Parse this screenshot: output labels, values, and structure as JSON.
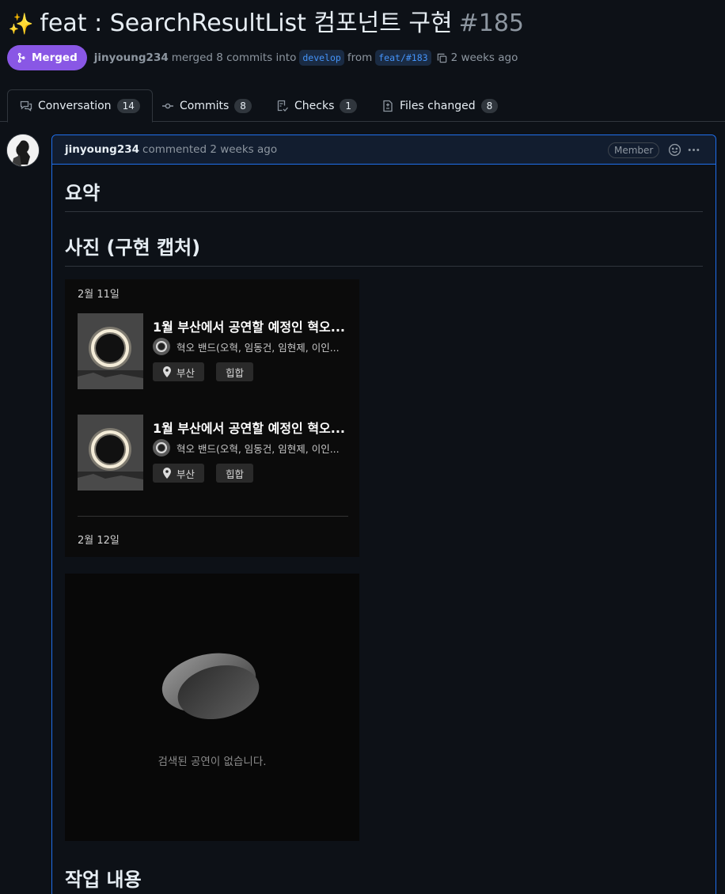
{
  "pr": {
    "title": "feat : SearchResultList 컴포넌트 구현",
    "number": "#185",
    "state": "Merged",
    "author": "jinyoung234",
    "merge_text": "merged 8 commits into",
    "base_branch": "develop",
    "from_text": "from",
    "head_branch": "feat/#183",
    "time": "2 weeks ago"
  },
  "tabs": [
    {
      "label": "Conversation",
      "count": "14",
      "icon": "comment-discussion-icon"
    },
    {
      "label": "Commits",
      "count": "8",
      "icon": "git-commit-icon"
    },
    {
      "label": "Checks",
      "count": "1",
      "icon": "checklist-icon"
    },
    {
      "label": "Files changed",
      "count": "8",
      "icon": "file-diff-icon"
    }
  ],
  "comment": {
    "author": "jinyoung234",
    "action": "commented 2 weeks ago",
    "badge": "Member"
  },
  "body": {
    "h_summary": "요약",
    "h_photos": "사진 (구현 캡처)",
    "h_work": "작업 내용"
  },
  "screenshot1": {
    "date1": "2월 11일",
    "date2": "2월 12일",
    "cards": [
      {
        "title": "1월 부산에서 공연할 예정인 혁오...",
        "artist": "혁오 밴드(오혁, 임동건, 임현제, 이인...",
        "location": "부산",
        "genre": "힙합"
      },
      {
        "title": "1월 부산에서 공연할 예정인 혁오...",
        "artist": "혁오 밴드(오혁, 임동건, 임현제, 이인...",
        "location": "부산",
        "genre": "힙합"
      }
    ]
  },
  "screenshot2": {
    "empty_message": "검색된 공연이 없습니다."
  },
  "colors": {
    "merged": "#8957e5",
    "link": "#4493f8",
    "border_active": "#1f6feb"
  }
}
